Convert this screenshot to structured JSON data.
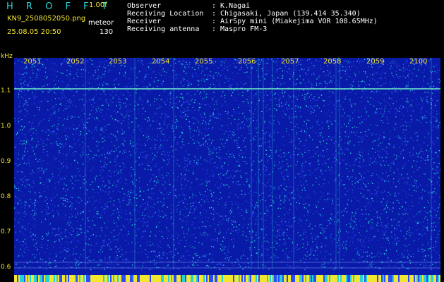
{
  "header": {
    "app_name": "H R O F F T",
    "version": "1.00f",
    "filename": "KN9_2508052050.png",
    "mode": "meteor",
    "timestamp": "25.08.05 20:50",
    "count": "130",
    "meta": [
      {
        "key": "Observer",
        "value": ": K.Nagai"
      },
      {
        "key": "Receiving Location",
        "value": ": Chigasaki, Japan (139.414 35.340)"
      },
      {
        "key": "Receiver",
        "value": ": AirSpy mini (Miakejima VOR 108.65MHz)"
      },
      {
        "key": "Receiving antenna",
        "value": ": Maspro FM-3"
      }
    ]
  },
  "spectrogram": {
    "unit": "kHz",
    "time_labels": [
      "2051",
      "2052",
      "2053",
      "2054",
      "2055",
      "2056",
      "2057",
      "2058",
      "2059",
      "2100"
    ],
    "freq_labels": [
      "1.1",
      "1.0",
      "0.9",
      "0.8",
      "0.7",
      "0.6"
    ],
    "colors": {
      "background": "#0a1aa8",
      "noise_hi": "#23d4d4",
      "noise_lo": "#2a4cff",
      "label": "#f2e62e",
      "carrier": "#6ef0c8"
    }
  }
}
